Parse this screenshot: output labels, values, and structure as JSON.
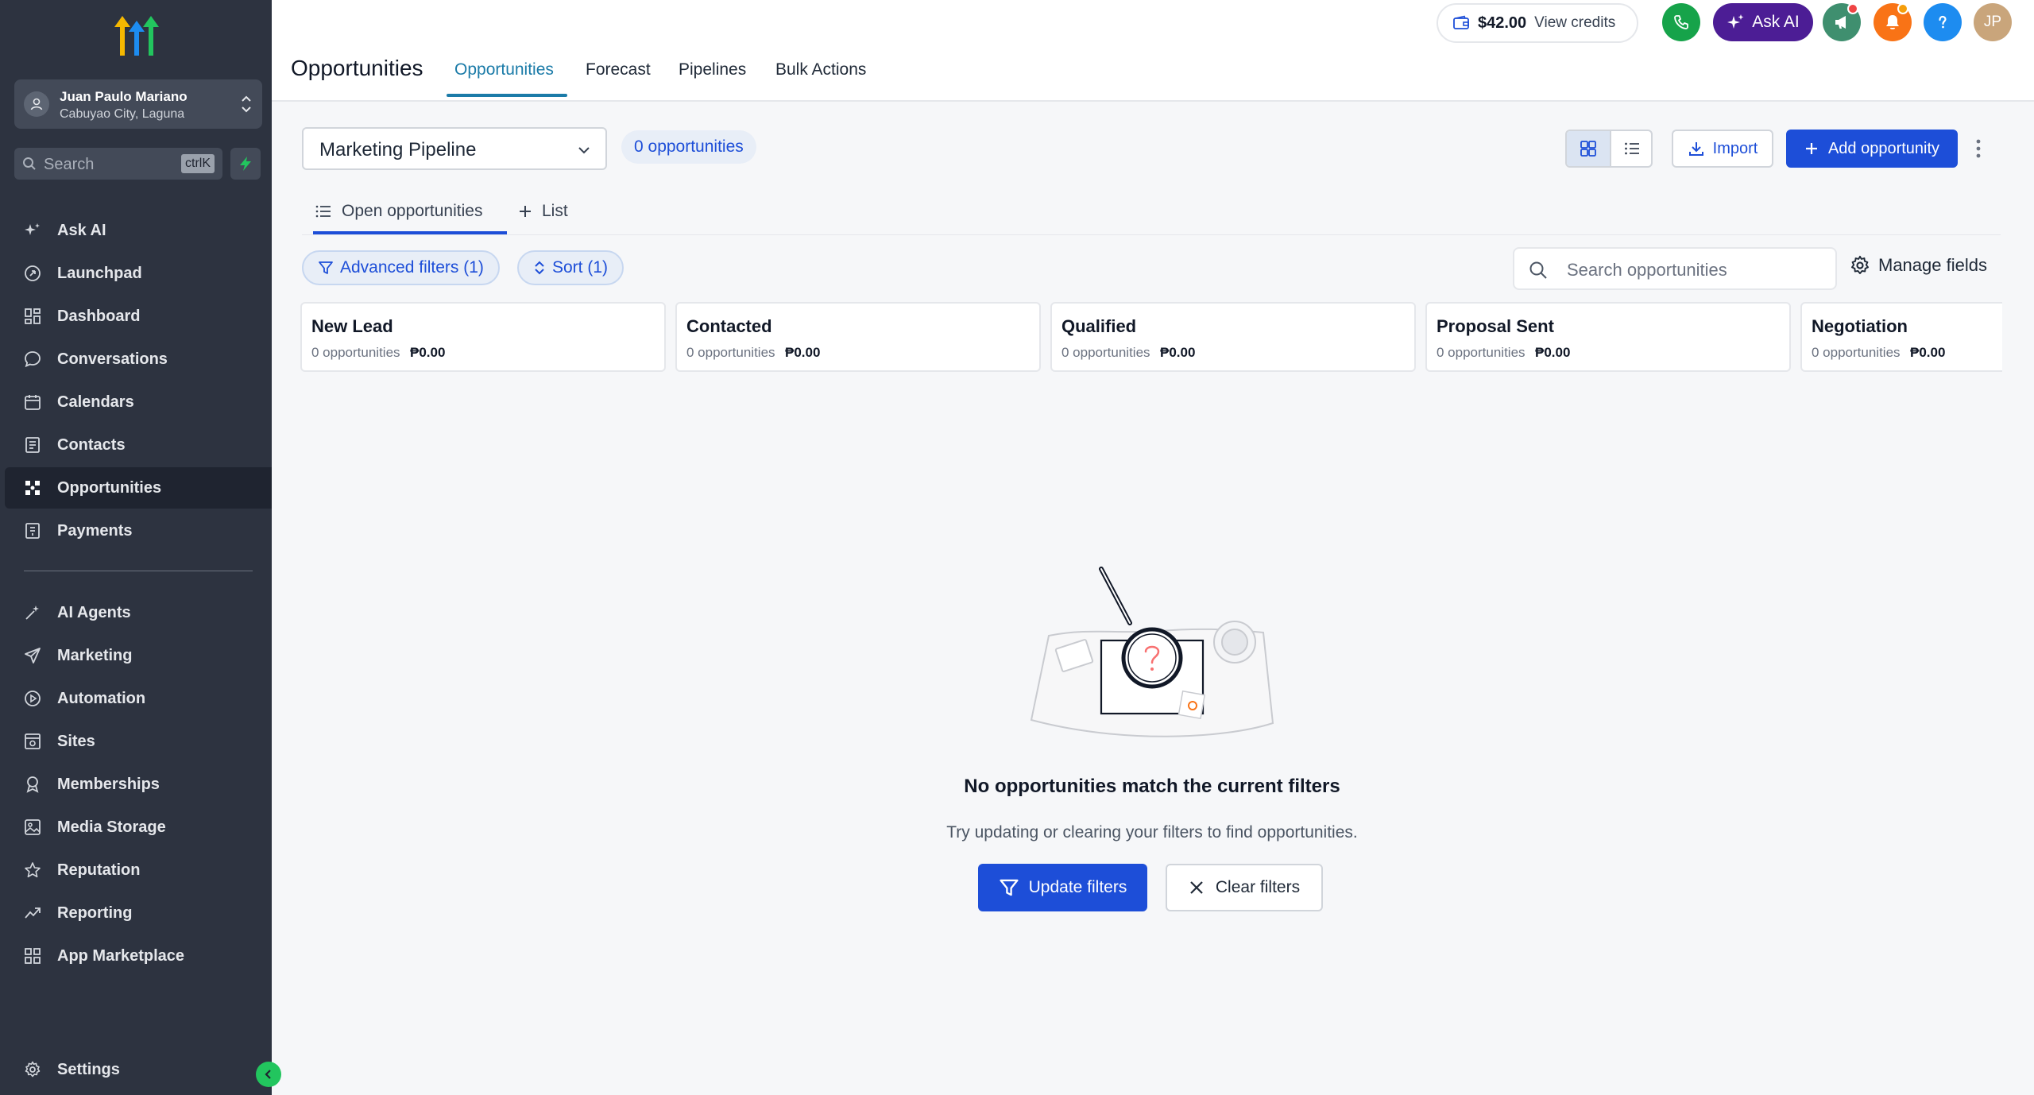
{
  "sidebar": {
    "account": {
      "name": "Juan Paulo Mariano",
      "location": "Cabuyao City, Laguna"
    },
    "search": {
      "placeholder": "Search",
      "shortcut": "ctrlK"
    },
    "items": [
      {
        "label": "Ask AI",
        "icon": "sparkles-icon"
      },
      {
        "label": "Launchpad",
        "icon": "rocket-icon"
      },
      {
        "label": "Dashboard",
        "icon": "dashboard-icon"
      },
      {
        "label": "Conversations",
        "icon": "chat-bubble-icon"
      },
      {
        "label": "Calendars",
        "icon": "calendar-icon"
      },
      {
        "label": "Contacts",
        "icon": "contacts-icon"
      },
      {
        "label": "Opportunities",
        "icon": "opportunities-icon",
        "active": true
      },
      {
        "label": "Payments",
        "icon": "payments-icon"
      }
    ],
    "items2": [
      {
        "label": "AI Agents",
        "icon": "ai-agents-icon"
      },
      {
        "label": "Marketing",
        "icon": "send-icon"
      },
      {
        "label": "Automation",
        "icon": "automation-icon"
      },
      {
        "label": "Sites",
        "icon": "sites-icon"
      },
      {
        "label": "Memberships",
        "icon": "award-icon"
      },
      {
        "label": "Media Storage",
        "icon": "image-icon"
      },
      {
        "label": "Reputation",
        "icon": "star-icon"
      },
      {
        "label": "Reporting",
        "icon": "trending-icon"
      },
      {
        "label": "App Marketplace",
        "icon": "grid-icon"
      }
    ],
    "settings": {
      "label": "Settings",
      "icon": "gear-icon"
    }
  },
  "header": {
    "title": "Opportunities",
    "tabs": [
      {
        "label": "Opportunities",
        "active": true
      },
      {
        "label": "Forecast"
      },
      {
        "label": "Pipelines"
      },
      {
        "label": "Bulk Actions"
      }
    ],
    "credits": {
      "amount": "$42.00",
      "label": "View credits"
    },
    "ask_ai": "Ask AI",
    "avatar_initials": "JP"
  },
  "toolbar": {
    "pipeline": "Marketing Pipeline",
    "count_badge": "0 opportunities",
    "import_label": "Import",
    "add_label": "Add opportunity"
  },
  "subtabs": {
    "open": "Open opportunities",
    "list": "List"
  },
  "filters": {
    "advanced": "Advanced filters (1)",
    "sort": "Sort (1)",
    "search_placeholder": "Search opportunities",
    "manage_fields": "Manage fields"
  },
  "stages": [
    {
      "name": "New Lead",
      "count": "0 opportunities",
      "amount": "₱0.00"
    },
    {
      "name": "Contacted",
      "count": "0 opportunities",
      "amount": "₱0.00"
    },
    {
      "name": "Qualified",
      "count": "0 opportunities",
      "amount": "₱0.00"
    },
    {
      "name": "Proposal Sent",
      "count": "0 opportunities",
      "amount": "₱0.00"
    },
    {
      "name": "Negotiation",
      "count": "0 opportunities",
      "amount": "₱0.00"
    }
  ],
  "empty_state": {
    "title": "No opportunities match the current filters",
    "subtitle": "Try updating or clearing your filters to find opportunities.",
    "update_label": "Update filters",
    "clear_label": "Clear filters"
  },
  "colors": {
    "sidebar_bg": "#2d3340",
    "primary": "#1d4ed8",
    "tab_active": "#1b7ba8",
    "ask_ai": "#4c1d95",
    "phone": "#16a34a"
  }
}
